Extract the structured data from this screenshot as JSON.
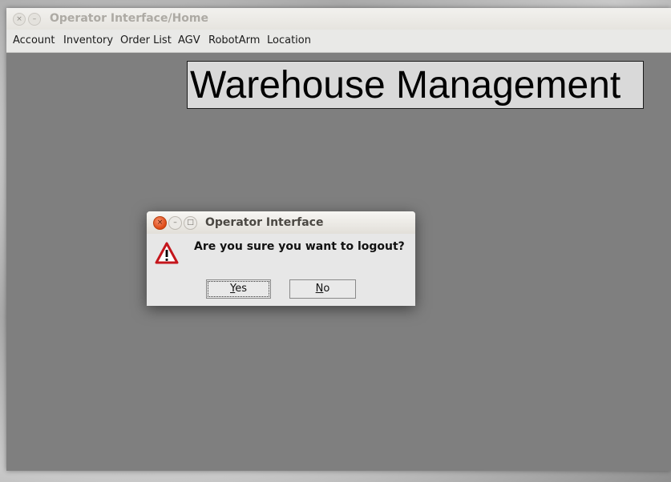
{
  "window": {
    "title": "Operator Interface/Home",
    "close_glyph": "×",
    "minimize_glyph": "–"
  },
  "menu": {
    "items": [
      "Account",
      "Inventory",
      "Order List",
      "AGV",
      "RobotArm",
      "Location"
    ]
  },
  "banner": {
    "text": "Warehouse Management"
  },
  "dialog": {
    "title": "Operator Interface",
    "close_glyph": "×",
    "minimize_glyph": "–",
    "maximize_glyph": "□",
    "message": "Are you sure you want to logout?",
    "icon": "warning-icon",
    "yes_mnemonic": "Y",
    "yes_rest": "es",
    "no_mnemonic": "N",
    "no_rest": "o"
  },
  "colors": {
    "content_bg": "#7f7f7f",
    "banner_bg": "#d9d9d9",
    "dialog_close": "#dd4814",
    "warning_red": "#c4161c"
  }
}
